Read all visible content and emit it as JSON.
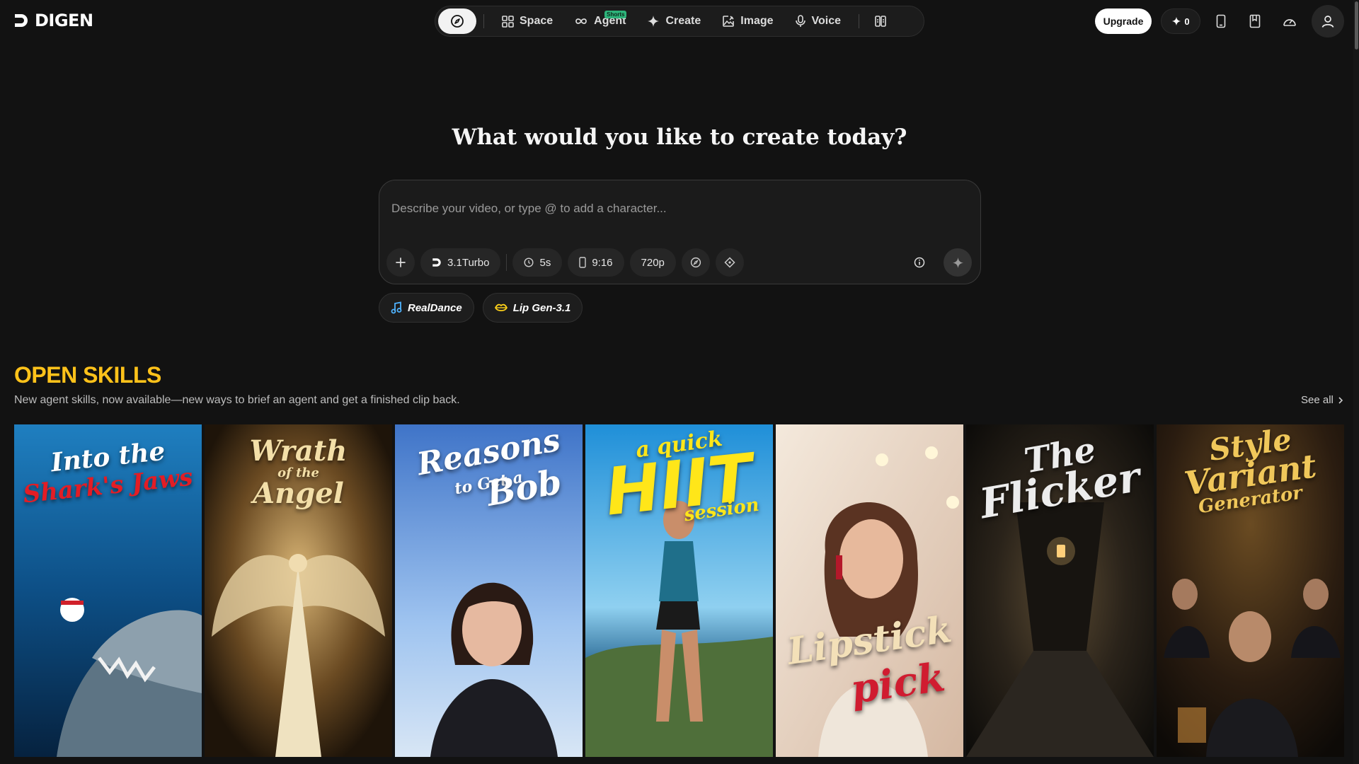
{
  "brand": {
    "name": "DIGEN"
  },
  "nav": {
    "items": [
      {
        "label": "Space",
        "icon": "grid-icon"
      },
      {
        "label": "Agent",
        "icon": "infinity-icon",
        "badge": "Shorts"
      },
      {
        "label": "Create",
        "icon": "sparkle-icon"
      },
      {
        "label": "Image",
        "icon": "image-edit-icon"
      },
      {
        "label": "Voice",
        "icon": "microphone-icon"
      }
    ]
  },
  "header": {
    "upgrade_label": "Upgrade",
    "credits": "0"
  },
  "hero": {
    "title": "What would you like to create today?",
    "prompt_placeholder": "Describe your video, or type @ to add a character...",
    "model": "3.1Turbo",
    "duration": "5s",
    "aspect_ratio": "9:16",
    "resolution": "720p"
  },
  "quick_actions": [
    {
      "label": "RealDance",
      "icon": "music-note-icon",
      "color": "#4fb3ff"
    },
    {
      "label": "Lip Gen-3.1",
      "icon": "lips-icon",
      "color": "#ffd21a"
    }
  ],
  "skills": {
    "title": "OPEN SKILLS",
    "subtitle": "New agent skills, now available—new ways to brief an agent and get a finished clip back.",
    "see_all": "See all",
    "cards": [
      {
        "line1": "Into the",
        "line2": "Shark's Jaws"
      },
      {
        "line1": "Wrath",
        "line2": "of the",
        "line3": "Angel"
      },
      {
        "line1": "Reasons",
        "line2": "to Get a",
        "line3": "Bob"
      },
      {
        "line1": "a quick",
        "line2": "HIIT",
        "line3": "session"
      },
      {
        "line1": "Lipstick",
        "line2": "pick"
      },
      {
        "line1": "The",
        "line2": "Flicker"
      },
      {
        "line1": "Style",
        "line2": "Variant",
        "line3": "Generator"
      }
    ]
  },
  "colors": {
    "accent_yellow": "#ffc21a",
    "badge_green": "#2db37a",
    "background": "#121212"
  }
}
